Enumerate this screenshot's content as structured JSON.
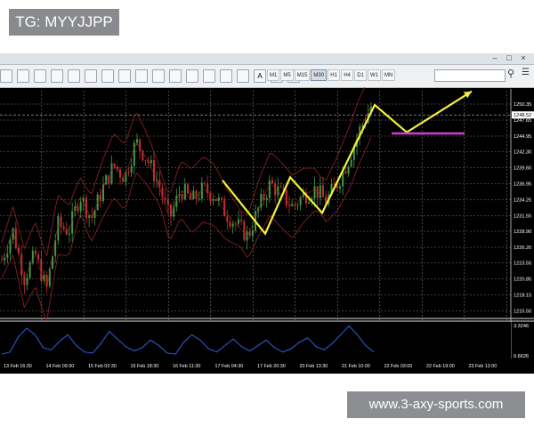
{
  "overlay": {
    "tg_label": "TG: MYYJJPP",
    "watermark": "www.3-axy-sports.com"
  },
  "window": {
    "buttons": [
      "–",
      "□",
      "×"
    ]
  },
  "toolbar": {
    "text_icons": [
      "A",
      "T"
    ],
    "timeframes": [
      "M1",
      "M5",
      "M15",
      "M30",
      "H1",
      "H4",
      "D1",
      "W1",
      "MN"
    ],
    "active_timeframe": "M30",
    "search_value": ""
  },
  "colors": {
    "background": "#000000",
    "bull_candle": "#3e9a45",
    "bear_candle": "#c03030",
    "bands": "#a0282c",
    "grid": "#7a7a7a",
    "arrow": "#f4f03a",
    "target_line": "#d63bd6",
    "indicator": "#2f5fe0"
  },
  "chart_data": {
    "type": "line",
    "price_axis_labels": [
      "1250.35",
      "1248.52",
      "1247.65",
      "1244.95",
      "1242.30",
      "1239.60",
      "1236.95",
      "1234.25",
      "1231.55",
      "1228.90",
      "1226.20",
      "1223.55",
      "1220.85",
      "1218.15",
      "1215.50"
    ],
    "current_price_label": "1248.52",
    "time_axis_labels": [
      "13 Feb 16:30",
      "14 Feb 09:30",
      "15 Feb 02:30",
      "15 Feb 18:30",
      "16 Feb 11:30",
      "17 Feb 04:30",
      "17 Feb 20:30",
      "20 Feb 13:30",
      "21 Feb 10:00",
      "22 Feb 03:00",
      "22 Feb 19:00",
      "23 Feb 12:00"
    ],
    "ylim": [
      1214.5,
      1252.0
    ],
    "price_path": [
      1224,
      1229,
      1221,
      1225,
      1219,
      1230,
      1229,
      1235,
      1231,
      1236,
      1240,
      1238,
      1244,
      1241,
      1237,
      1231,
      1236,
      1234,
      1236,
      1235,
      1232,
      1230,
      1228,
      1233,
      1237,
      1235,
      1233,
      1235,
      1236,
      1234,
      1237,
      1241,
      1246,
      1250
    ],
    "forecast_arrow": [
      {
        "x": "19 Feb",
        "y": 1237.5
      },
      {
        "x": "21 Feb 10:00",
        "y": 1228.5
      },
      {
        "x": "21 Feb 20:00",
        "y": 1238.0
      },
      {
        "x": "22 Feb 12:00",
        "y": 1232.0
      },
      {
        "x": "23 Feb 13:00",
        "y": 1250.2
      },
      {
        "x": "23 Feb 22:00",
        "y": 1245.6
      },
      {
        "x": "25 Feb 05:00",
        "y": 1252.5
      }
    ],
    "target_line": {
      "value": 1245.4,
      "from": "23 Feb 16:00",
      "to": "24 Feb 16:00"
    },
    "indicator_axis_labels": [
      "3.3246",
      "0.6626"
    ],
    "indicator_values": [
      0.8,
      1.0,
      2.4,
      3.2,
      2.6,
      1.4,
      1.2,
      2.0,
      2.6,
      1.6,
      1.0,
      0.9,
      1.8,
      2.9,
      2.2,
      1.5,
      1.1,
      1.4,
      2.1,
      1.6,
      0.9,
      0.8,
      1.9,
      2.6,
      2.1,
      1.3,
      1.0,
      1.6,
      2.2,
      1.5,
      1.1,
      1.6,
      2.1,
      1.4,
      1.0,
      1.3,
      1.9,
      2.3,
      1.5,
      1.2,
      1.8,
      2.6,
      3.4,
      2.6,
      1.6,
      1.0
    ]
  }
}
